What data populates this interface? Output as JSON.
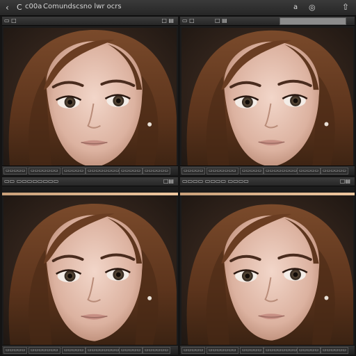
{
  "window": {
    "title": "Comundscsno lwr ocrs",
    "brand": "c00a",
    "icons": [
      "back-arrow-icon",
      "c-icon",
      "a-icon",
      "share-icon",
      "upload-icon"
    ]
  },
  "panels": [
    {
      "header_left": "▭ □",
      "header_right": "□ ▤",
      "footer": [
        "▭▭▭▭▭",
        "▭▭▭▭▭▭▭",
        "▭▭▭▭▭",
        "▭▭▭▭▭▭▭▭",
        "▭▭▭▭▭",
        "▭▭▭▭▭▭",
        "▭▭▭▭▭"
      ]
    },
    {
      "header_left": "▭ □",
      "header_right": "□ ▤",
      "footer": [
        "▭▭▭▭▭",
        "▭▭▭▭▭▭▭",
        "▭▭▭▭▭",
        "▭▭▭▭▭▭▭▭",
        "▭▭▭▭▭",
        "▭▭▭▭▭▭",
        "▭▭▭▭▭"
      ]
    },
    {
      "header_left": "▭▭ ▭▭▭▭▭▭▭▭",
      "header_right": "□▤",
      "footer": [
        "▭▭▭▭▭",
        "▭▭▭▭▭▭▭",
        "▭▭▭▭▭",
        "▭▭▭▭▭▭▭▭",
        "▭▭▭▭▭",
        "▭▭▭▭▭▭",
        "▭▭▭▭▭"
      ]
    },
    {
      "header_left": "▭▭▭▭ ▭▭▭▭ ▭▭▭▭",
      "header_right": "□▤",
      "footer": [
        "▭▭▭▭▭",
        "▭▭▭▭▭▭▭",
        "▭▭▭▭▭",
        "▭▭▭▭▭▭▭▭",
        "▭▭▭▭▭",
        "▭▭▭▭▭▭",
        "▭▭▭▭▭"
      ]
    }
  ],
  "colors": {
    "background": "#141414",
    "toolbar": "#2c2c2c",
    "accent": "#e3b48a",
    "hair": "#6b3e22",
    "skin": "#e5c2b3"
  }
}
